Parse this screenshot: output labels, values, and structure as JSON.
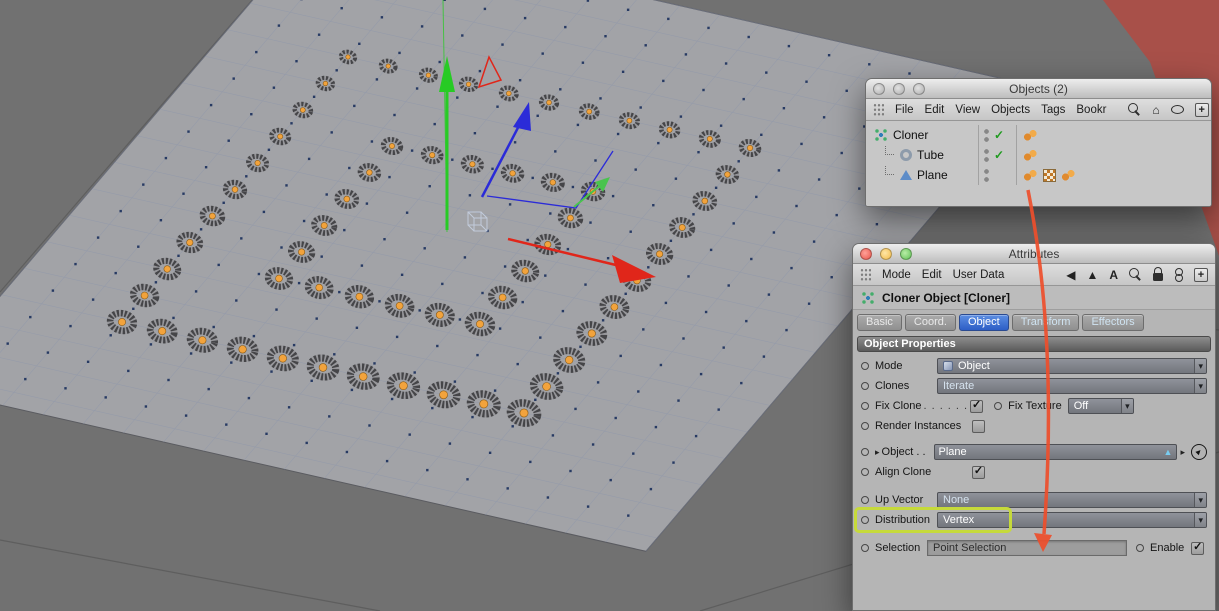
{
  "viewport": {
    "bg_color": "#717171",
    "plane_color": "#a2a3a7",
    "plane_edge_color": "#5a5b60",
    "grid_dot_color": "#273a63",
    "grid_line_color": "#8792ad",
    "clone_ring_color": "#454548",
    "clone_center_color": "#f2a33c",
    "red_object_color": "#a85049",
    "annotation_arrow_color": "#ee4e2b",
    "highlight_color": "#c6da3a",
    "axis_colors": {
      "x": "#e0261a",
      "y": "#27cb24",
      "z": "#2b2bd8"
    },
    "clone_rings": [
      {
        "min": 0,
        "max": 1,
        "step": 0.1
      },
      {
        "min": 0.25,
        "max": 0.75,
        "step": 0.1
      }
    ]
  },
  "objects_panel": {
    "title": "Objects (2)",
    "menu": [
      "File",
      "Edit",
      "View",
      "Objects",
      "Tags",
      "Bookr"
    ],
    "tree": [
      {
        "name": "Cloner"
      },
      {
        "name": "Tube"
      },
      {
        "name": "Plane"
      }
    ]
  },
  "attributes_panel": {
    "title": "Attributes",
    "menu": [
      "Mode",
      "Edit",
      "User Data"
    ],
    "object_header": "Cloner Object [Cloner]",
    "tabs": [
      "Basic",
      "Coord.",
      "Object",
      "Transform",
      "Effectors"
    ],
    "section_title": "Object Properties",
    "rows": {
      "mode": {
        "label": "Mode",
        "value": "Object"
      },
      "clones": {
        "label": "Clones",
        "value": "Iterate"
      },
      "fix_clone": {
        "label": "Fix Clone",
        "leader": ". . . . . .",
        "checked": true
      },
      "fix_texture": {
        "label": "Fix Texture",
        "value": "Off"
      },
      "render_instances": {
        "label": "Render Instances",
        "checked": false
      },
      "object": {
        "label": "Object . .",
        "value": "Plane"
      },
      "align_clone": {
        "label": "Align Clone",
        "checked": true
      },
      "up_vector": {
        "label": "Up Vector",
        "value": "None"
      },
      "distribution": {
        "label": "Distribution",
        "value": "Vertex"
      },
      "selection": {
        "label": "Selection",
        "value": "Point Selection",
        "enable_label": "Enable",
        "enable_checked": true
      }
    }
  },
  "icons": {
    "check": "✓",
    "chevron": "▾",
    "home": "⌂",
    "plus": "+",
    "back": "◀",
    "mode_arrow": "▲",
    "letter_a": "A",
    "disclosure": "▸",
    "link_arrow": "▲",
    "pick": "►"
  }
}
